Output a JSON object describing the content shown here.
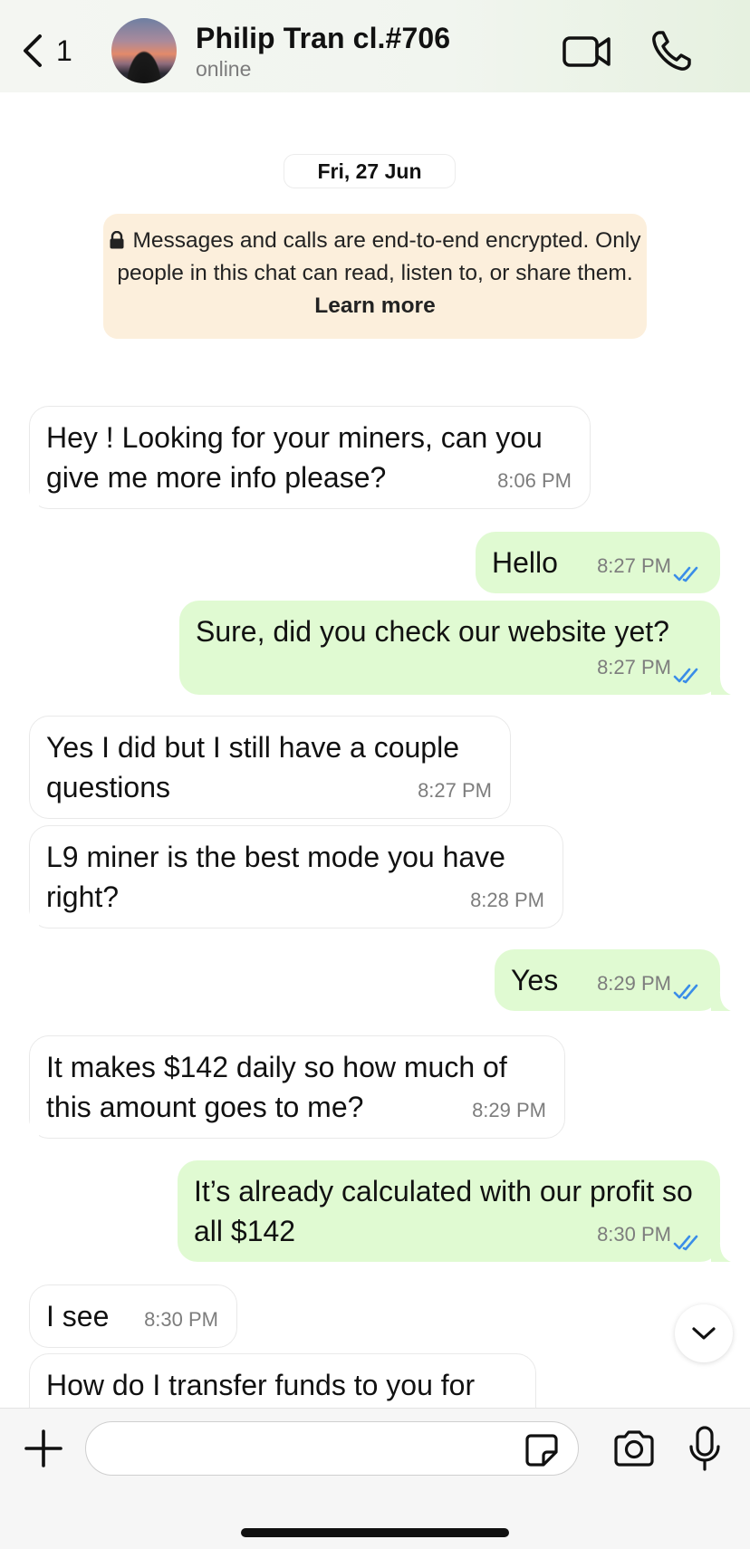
{
  "header": {
    "back_count": "1",
    "contact_name": "Philip Tran cl.#706",
    "status": "online"
  },
  "chat": {
    "date": "Fri, 27 Jun",
    "encryption": {
      "text": "Messages and calls are end-to-end encrypted. Only people in this chat can read, listen to, or share them.",
      "link": "Learn more"
    },
    "messages": [
      {
        "dir": "in",
        "text": "Hey ! Looking for your miners, can you give me more info please?",
        "time": "8:06 PM"
      },
      {
        "dir": "out",
        "text": "Hello",
        "time": "8:27 PM"
      },
      {
        "dir": "out",
        "text": "Sure, did you check our website yet?",
        "time": "8:27 PM"
      },
      {
        "dir": "in",
        "text": "Yes I did but I still have a couple questions",
        "time": "8:27 PM"
      },
      {
        "dir": "in",
        "text": "L9 miner is the best mode you have right?",
        "time": "8:28 PM"
      },
      {
        "dir": "out",
        "text": "Yes",
        "time": "8:29 PM"
      },
      {
        "dir": "in",
        "text": "It makes $142 daily so how much of this amount goes to me?",
        "time": "8:29 PM"
      },
      {
        "dir": "out",
        "text": "It’s already calculated with our profit so all $142",
        "time": "8:30 PM"
      },
      {
        "dir": "in",
        "text": "I see",
        "time": "8:30 PM"
      },
      {
        "dir": "in",
        "text": "How do I transfer funds to you for",
        "time": ""
      }
    ]
  },
  "input": {
    "placeholder": ""
  },
  "colors": {
    "outgoing_bubble": "#e0fad2",
    "incoming_bubble": "#ffffff",
    "read_ticks": "#3a8de8",
    "encryption_notice": "#fcefdc"
  }
}
